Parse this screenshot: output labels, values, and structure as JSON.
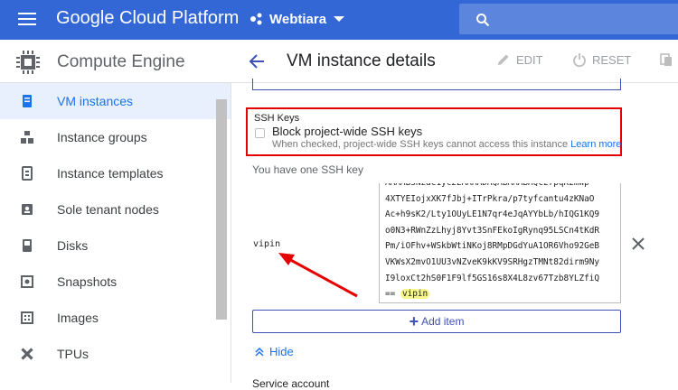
{
  "topbar": {
    "brand": "Google Cloud Platform",
    "project_name": "Webtiara",
    "icons": [
      "hamburger-menu-icon",
      "project-dots-icon",
      "dropdown-caret-icon",
      "search-icon"
    ],
    "colors": {
      "bar": "#3367d6",
      "search": "#5c85de"
    }
  },
  "nav": {
    "product": "Compute Engine",
    "items": [
      {
        "label": "VM instances",
        "icon": "vm-instances-icon",
        "active": true
      },
      {
        "label": "Instance groups",
        "icon": "instance-groups-icon"
      },
      {
        "label": "Instance templates",
        "icon": "instance-templates-icon"
      },
      {
        "label": "Sole tenant nodes",
        "icon": "sole-tenant-nodes-icon"
      },
      {
        "label": "Disks",
        "icon": "disks-icon"
      },
      {
        "label": "Snapshots",
        "icon": "snapshots-icon"
      },
      {
        "label": "Images",
        "icon": "images-icon"
      },
      {
        "label": "TPUs",
        "icon": "tpus-icon"
      }
    ]
  },
  "header": {
    "title": "VM instance details",
    "edit_label": "EDIT",
    "reset_label": "RESET"
  },
  "ssh": {
    "section_title": "SSH Keys",
    "block_label": "Block project-wide SSH keys",
    "block_checked": false,
    "help_text": "When checked, project-wide SSH keys cannot access this instance",
    "learn_more": "Learn more",
    "count_label": "You have one SSH key",
    "key": {
      "username": "vipin",
      "lines": [
        "4XTYEIojxXK7fJbj+ITrPkra/p7tyfcantu4zKNaO",
        "Ac+h9sK2/Lty1OUyLE1N7qr4eJqAYYbLb/hIQG1KQ9",
        "o0N3+RWnZzLhyj8Yvt3SnFEkoIgRynq95LSCn4tKdR",
        "Pm/iOFhv+WSkbWtiNKoj8RMpDGdYuA1OR6Vho92GeB",
        "VKWsX2mvO1UU3vNZveK9kKV9SRHgzTMNt82dirm9Ny",
        "I9loxCt2hS0F1F9lf5GS16s8X4L8zv67Tzb8YLZfiQ"
      ],
      "last_line_prefix": "== ",
      "last_line_user": "vipin"
    },
    "add_item_label": "Add item",
    "hide_label": "Hide"
  },
  "next_section_label": "Service account",
  "annotation_color": "#e60000"
}
